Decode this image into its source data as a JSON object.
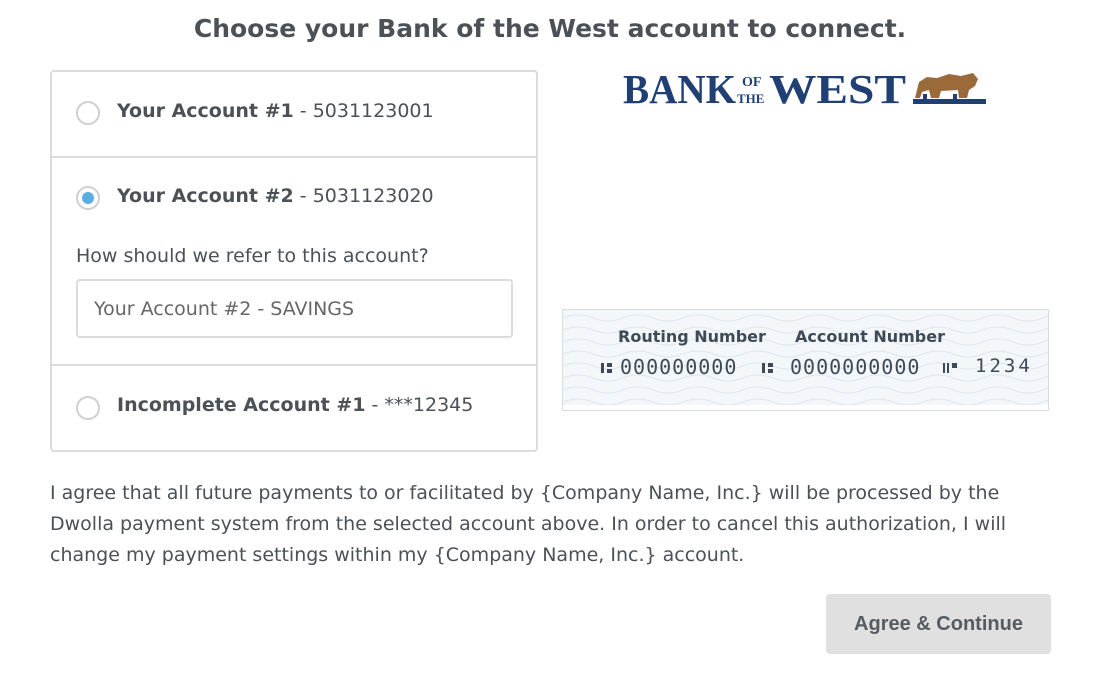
{
  "page": {
    "title": "Choose your Bank of the West account to connect."
  },
  "accounts": [
    {
      "name": "Your Account #1",
      "separator": " - ",
      "number": "5031123001",
      "selected": false
    },
    {
      "name": "Your Account #2",
      "separator": " - ",
      "number": "5031123020",
      "selected": true
    },
    {
      "name": "Incomplete Account #1",
      "separator": " - ",
      "number": "***12345",
      "selected": false
    }
  ],
  "nickname": {
    "prompt": "How should we refer to this account?",
    "value": "Your Account #2 - SAVINGS"
  },
  "bank_logo": {
    "word_left": "BANK",
    "word_of": "OF",
    "word_the": "THE",
    "word_right": "WEST",
    "brand_color": "#1f3f75",
    "bear_color": "#9a6a3a"
  },
  "check": {
    "routing_label": "Routing Number",
    "account_label": "Account Number",
    "routing_digits": "000000000",
    "account_digits": "0000000000",
    "check_number": "1234"
  },
  "agreement": {
    "text": "I agree that all future payments to or facilitated by {Company Name, Inc.} will be processed by the Dwolla payment system from the selected account above. In order to cancel this authorization, I will change my payment settings within my {Company Name, Inc.} account."
  },
  "actions": {
    "agree_label": "Agree & Continue"
  },
  "colors": {
    "radio_selected": "#5aaee0",
    "border": "#dcdcdc",
    "text": "#4b5157",
    "button_bg": "#e0e0e0"
  }
}
